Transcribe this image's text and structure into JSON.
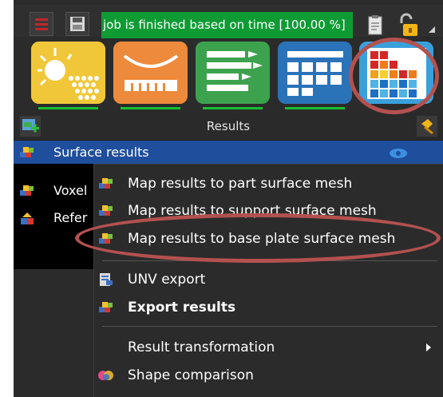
{
  "status": {
    "text": "job is finished based on time [100.00 %]",
    "color": "#0e9b33"
  },
  "toolbar": {
    "menu_icon": "hamburger-icon",
    "save_icon": "save-icon",
    "clipboard_icon": "clipboard-icon",
    "lock_icon": "unlock-icon",
    "dropdown_icon": "chevron-down-icon"
  },
  "tiles": [
    "build-process-icon",
    "support-icon",
    "process-list-icon",
    "table-icon",
    "results-heatmap-icon"
  ],
  "results_panel": {
    "title": "Results",
    "add_icon": "add-result-icon",
    "pin_icon": "pin-icon"
  },
  "tree": {
    "items": [
      {
        "label": "Surface results",
        "icon": "cubes-icon",
        "selected": true,
        "eye_icon": "eye-icon"
      },
      {
        "label": "Voxel",
        "icon": "cubes-icon",
        "selected": false
      },
      {
        "label": "Refer",
        "icon": "shapes-icon",
        "selected": false
      }
    ]
  },
  "context_menu": {
    "items": [
      {
        "label": "Map results to part surface mesh",
        "icon": "cubes-icon"
      },
      {
        "label": "Map results to support surface mesh",
        "icon": "cubes-icon"
      },
      {
        "label": "Map results to base plate surface mesh",
        "icon": "cubes-icon"
      },
      {
        "label": "UNV export",
        "icon": "export-file-icon"
      },
      {
        "label": "Export results",
        "icon": "cubes-icon",
        "bold": true
      },
      {
        "label": "Result transformation",
        "submenu_icon": "chevron-right-icon"
      },
      {
        "label": "Shape comparison",
        "icon": "shape-comparison-icon"
      }
    ]
  },
  "highlight_color": "#b3514f",
  "accent_selected": "#1f4e9c"
}
